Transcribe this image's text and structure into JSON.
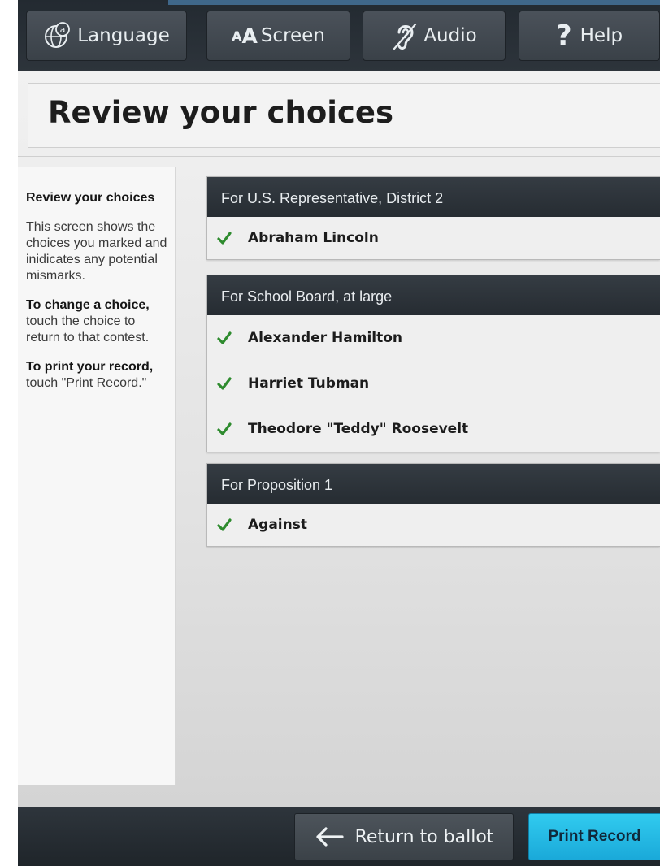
{
  "toolbar": {
    "language_label": "Language",
    "screen_small_a": "A",
    "screen_big_a": "A",
    "screen_label": "Screen",
    "audio_label": "Audio",
    "help_mark": "?",
    "help_label": "Help"
  },
  "page_title": "Review your choices",
  "help_panel": {
    "heading": "Review your choices",
    "intro": "This screen shows the choices you marked and inidicates any potential mismarks.",
    "change_bold": "To change a choice,",
    "change_text": " touch the choice to return to that contest.",
    "print_bold": "To print your record,",
    "print_text": " touch \"Print Record.\""
  },
  "contests": [
    {
      "header": "For U.S. Representative, District 2",
      "choices": [
        "Abraham Lincoln"
      ]
    },
    {
      "header": "For School Board, at large",
      "choices": [
        "Alexander Hamilton",
        "Harriet Tubman",
        "Theodore \"Teddy\" Roosevelt"
      ]
    },
    {
      "header": "For Proposition 1",
      "choices": [
        "Against"
      ]
    }
  ],
  "footer": {
    "return_label": "Return to ballot",
    "print_label": "Print Record"
  },
  "colors": {
    "check": "#2e8b2e",
    "print_button": "#23b8e6",
    "header_bg": "#2b3137"
  },
  "icons": {
    "language": "language-icon",
    "audio": "ear-icon",
    "check": "check-icon",
    "return": "arrow-left-icon"
  }
}
